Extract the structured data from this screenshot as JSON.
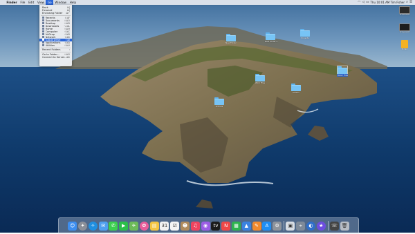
{
  "menubar": {
    "app_name": "Finder",
    "menus": [
      "File",
      "Edit",
      "View",
      "Go",
      "Window",
      "Help"
    ],
    "active_menu": "Go",
    "status_text": "Thu 10:01 AM   Tim Fisher"
  },
  "go_menu": {
    "items": [
      {
        "label": "Back",
        "shortcut": "⌘[",
        "icon": "none",
        "style": "plain"
      },
      {
        "label": "Forward",
        "shortcut": "⌘]",
        "icon": "none",
        "style": "plain"
      },
      {
        "label": "Enclosing Folder",
        "shortcut": "⌘↑",
        "icon": "none",
        "style": "plain"
      },
      {
        "sep": true
      },
      {
        "label": "Recents",
        "shortcut": "⇧⌘F",
        "icon": "recents-icon"
      },
      {
        "label": "Documents",
        "shortcut": "⇧⌘O",
        "icon": "documents-icon"
      },
      {
        "label": "Desktop",
        "shortcut": "⇧⌘D",
        "icon": "desktop-icon"
      },
      {
        "label": "Downloads",
        "shortcut": "⌥⌘L",
        "icon": "downloads-icon"
      },
      {
        "label": "Home",
        "shortcut": "⇧⌘H",
        "icon": "home-icon"
      },
      {
        "label": "Computer",
        "shortcut": "⇧⌘C",
        "icon": "computer-icon"
      },
      {
        "label": "AirDrop",
        "shortcut": "⇧⌘R",
        "icon": "airdrop-icon"
      },
      {
        "label": "Network",
        "shortcut": "⇧⌘K",
        "icon": "network-icon"
      },
      {
        "label": "iCloud Drive",
        "shortcut": "⇧⌘I",
        "icon": "icloud-icon",
        "highlighted": true
      },
      {
        "label": "Applications",
        "shortcut": "⇧⌘A",
        "icon": "applications-icon"
      },
      {
        "label": "Utilities",
        "shortcut": "⇧⌘U",
        "icon": "utilities-icon"
      },
      {
        "sep": true
      },
      {
        "label": "Recent Folders",
        "shortcut": "›",
        "icon": "none",
        "style": "plain"
      },
      {
        "sep": true
      },
      {
        "label": "Go to Folder...",
        "shortcut": "⇧⌘G",
        "icon": "none",
        "style": "plain"
      },
      {
        "label": "Connect to Server...",
        "shortcut": "⌘K",
        "icon": "none",
        "style": "plain"
      }
    ]
  },
  "desktop": {
    "folders": [
      {
        "label": "New Folder",
        "selected": false
      },
      {
        "label": "New Folder 2",
        "selected": false
      },
      {
        "label": "Projects",
        "selected": false
      },
      {
        "label": "Work Files",
        "selected": false
      },
      {
        "label": "Photos",
        "selected": false
      },
      {
        "label": "Music Files",
        "selected": true
      },
      {
        "label": "Archive",
        "selected": false
      }
    ],
    "right_items": [
      {
        "label": "Screenshot",
        "color": "#2b2b2b"
      },
      {
        "label": "Screenshot",
        "color": "#1e1e1e"
      },
      {
        "label": "Notes",
        "color": "#f4b223"
      }
    ]
  },
  "dock": {
    "apps": [
      {
        "name": "finder-icon",
        "glyph": "☺",
        "color": "#3d8ef0"
      },
      {
        "name": "launchpad-icon",
        "glyph": "✦",
        "color": "#8b8f98",
        "round": true
      },
      {
        "name": "safari-icon",
        "glyph": "✧",
        "color": "#1f8fe0",
        "round": true
      },
      {
        "name": "mail-icon",
        "glyph": "✉",
        "color": "#4fa0ef"
      },
      {
        "name": "messages-icon",
        "glyph": "✆",
        "color": "#3ccf4e"
      },
      {
        "name": "facetime-icon",
        "glyph": "▶",
        "color": "#2bbf4a"
      },
      {
        "name": "maps-icon",
        "glyph": "✈",
        "color": "#6dbb59"
      },
      {
        "name": "photos-icon",
        "glyph": "✿",
        "color": "#e85d9a",
        "round": true
      },
      {
        "name": "notes-icon",
        "glyph": "▤",
        "color": "#f5c542"
      },
      {
        "name": "calendar-icon",
        "glyph": "31",
        "color": "#f2f2f2"
      },
      {
        "name": "reminders-icon",
        "glyph": "☑",
        "color": "#f4f4f4"
      },
      {
        "name": "contacts-icon",
        "glyph": "☻",
        "color": "#b08b5c"
      },
      {
        "name": "music-icon",
        "glyph": "♫",
        "color": "#f0445f"
      },
      {
        "name": "podcasts-icon",
        "glyph": "◉",
        "color": "#9b5de5"
      },
      {
        "name": "tv-icon",
        "glyph": "tv",
        "color": "#1b1b1b"
      },
      {
        "name": "news-icon",
        "glyph": "N",
        "color": "#f04747"
      },
      {
        "name": "numbers-icon",
        "glyph": "▦",
        "color": "#2eb34e"
      },
      {
        "name": "keynote-icon",
        "glyph": "▲",
        "color": "#3a82e0"
      },
      {
        "name": "pages-icon",
        "glyph": "✎",
        "color": "#f08a2e"
      },
      {
        "name": "appstore-icon",
        "glyph": "A",
        "color": "#1e8ef4"
      },
      {
        "name": "system-preferences-icon",
        "glyph": "⚙",
        "color": "#8e949c"
      },
      {
        "name": "divider"
      },
      {
        "name": "preview-icon",
        "glyph": "▣",
        "color": "#d8dde4"
      },
      {
        "name": "screenshot-icon",
        "glyph": "⌖",
        "color": "#7e8a99"
      },
      {
        "name": "finder-window-icon",
        "glyph": "◐",
        "color": "#2f6ec9",
        "round": true
      },
      {
        "name": "imovie-icon",
        "glyph": "★",
        "color": "#6d4ee0",
        "round": true
      },
      {
        "name": "divider"
      },
      {
        "name": "downloads-stack-icon",
        "glyph": "☏",
        "color": "#444"
      },
      {
        "name": "trash-icon",
        "glyph": "🗑",
        "color": "#b7bcc4"
      }
    ]
  }
}
